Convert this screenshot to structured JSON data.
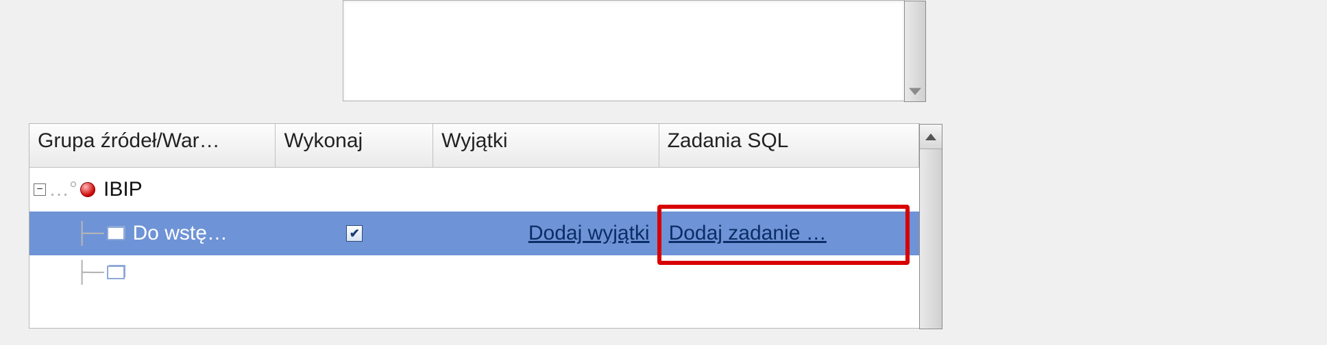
{
  "top_textarea": {
    "value": ""
  },
  "grid": {
    "columns": {
      "group": "Grupa źródeł/War…",
      "execute": "Wykonaj",
      "exceptions": "Wyjątki",
      "sql_tasks": "Zadania SQL"
    },
    "root_group": {
      "label": "IBIP",
      "expanded": true
    },
    "rows": [
      {
        "label": "Do wstę…",
        "execute_checked": true,
        "exceptions_link": "Dodaj wyjątki",
        "sql_link": "Dodaj zadanie …",
        "selected": true,
        "highlighted_sql": true
      }
    ]
  }
}
